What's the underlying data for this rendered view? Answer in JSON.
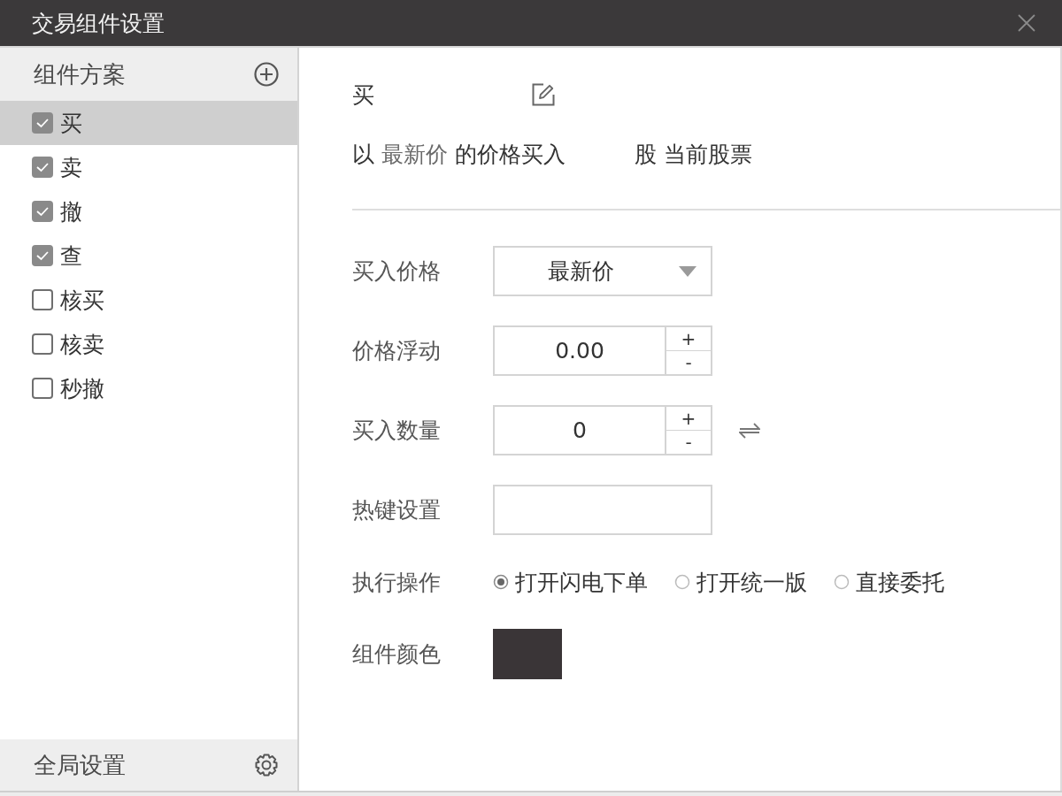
{
  "window": {
    "title": "交易组件设置"
  },
  "sidebar": {
    "heading": "组件方案",
    "items": [
      {
        "label": "买",
        "checked": true,
        "selected": true
      },
      {
        "label": "卖",
        "checked": true,
        "selected": false
      },
      {
        "label": "撤",
        "checked": true,
        "selected": false
      },
      {
        "label": "查",
        "checked": true,
        "selected": false
      },
      {
        "label": "核买",
        "checked": false,
        "selected": false
      },
      {
        "label": "核卖",
        "checked": false,
        "selected": false
      },
      {
        "label": "秒撤",
        "checked": false,
        "selected": false
      }
    ],
    "footer": "全局设置"
  },
  "detail": {
    "name": "买",
    "summary": {
      "lead": "以",
      "price": "最新价",
      "rest": "的价格买入",
      "tail": "股 当前股票"
    },
    "form": [
      {
        "kind": "select",
        "label": "买入价格",
        "value": "最新价"
      },
      {
        "kind": "spinner",
        "label": "价格浮动",
        "value": "0.00",
        "plus": "+",
        "minus": "-"
      },
      {
        "kind": "spinner",
        "label": "买入数量",
        "value": "0",
        "plus": "+",
        "minus": "-",
        "swap": true
      },
      {
        "kind": "hotkey",
        "label": "热键设置"
      },
      {
        "kind": "radio",
        "label": "执行操作",
        "options": [
          {
            "label": "打开闪电下单",
            "selected": true
          },
          {
            "label": "打开统一版",
            "selected": false
          },
          {
            "label": "直接委托",
            "selected": false
          }
        ]
      },
      {
        "kind": "color",
        "label": "组件颜色",
        "color": "#3a3537"
      }
    ]
  }
}
